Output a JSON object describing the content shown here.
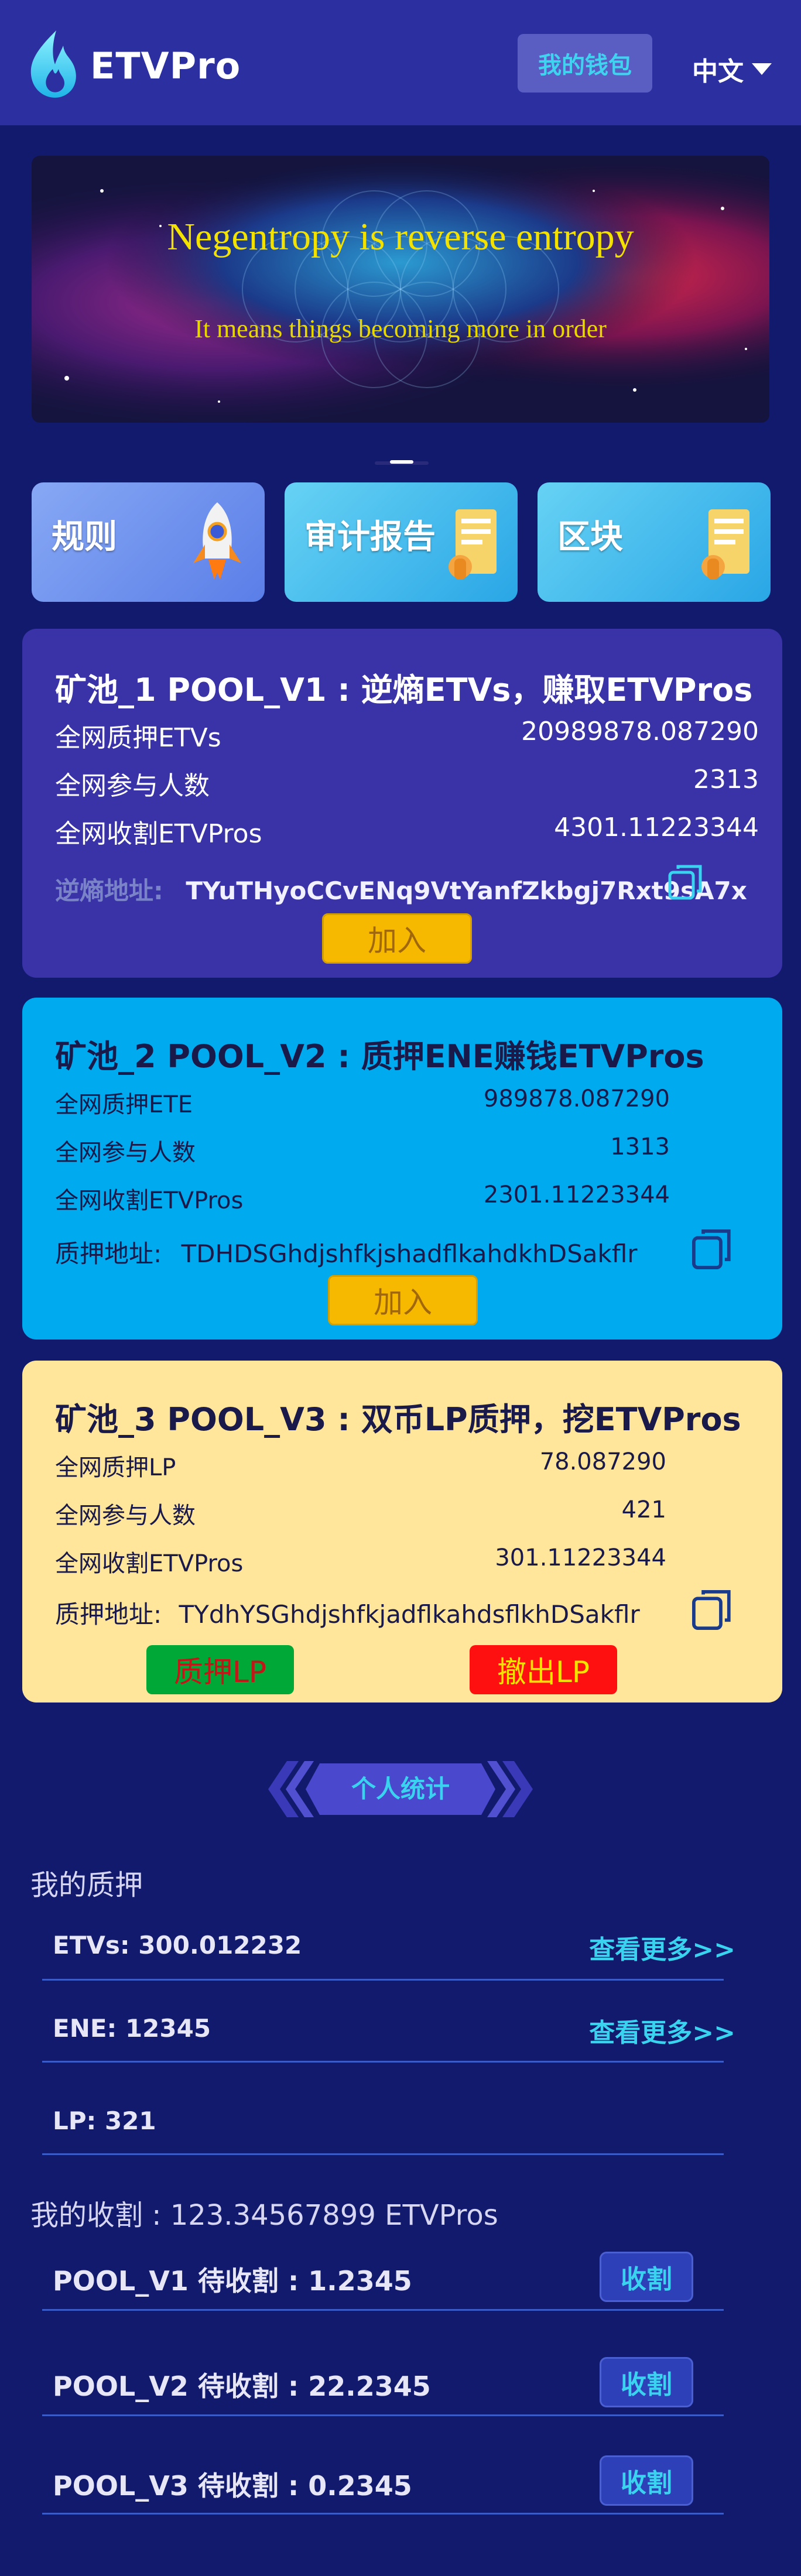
{
  "header": {
    "brand": "ETVPro",
    "wallet_label": "我的钱包",
    "lang_label": "中文"
  },
  "banner": {
    "line1": "Negentropy is reverse entropy",
    "line2": "It means things becoming more in order"
  },
  "nav": [
    {
      "label": "规则",
      "icon": "rocket-icon"
    },
    {
      "label": "审计报告",
      "icon": "report-icon"
    },
    {
      "label": "区块",
      "icon": "block-icon"
    }
  ],
  "pools": [
    {
      "title": "矿池_1  POOL_V1 : 逆熵ETVs，赚取ETVPros",
      "rows": [
        {
          "label": "全网质押ETVs",
          "value": "20989878.087290"
        },
        {
          "label": "全网参与人数",
          "value": "2313"
        },
        {
          "label": "全网收割ETVPros",
          "value": "4301.11223344"
        }
      ],
      "addr_label": "逆熵地址:",
      "addr": "TYuTHyoCCvENq9VtYanfZkbgj7Rxt9sA7x",
      "button": "加入",
      "bg": "#3a33a8"
    },
    {
      "title": "矿池_2  POOL_V2 : 质押ENE赚钱ETVPros",
      "rows": [
        {
          "label": "全网质押ETE",
          "value": "989878.087290"
        },
        {
          "label": "全网参与人数",
          "value": "1313"
        },
        {
          "label": "全网收割ETVPros",
          "value": "2301.11223344"
        }
      ],
      "addr_label": "质押地址:",
      "addr": "TDHDSGhdjshfkjshadflkahdkhDSakflr",
      "button": "加入",
      "bg": "#00aaee"
    },
    {
      "title": "矿池_3  POOL_V3 : 双币LP质押，挖ETVPros",
      "rows": [
        {
          "label": "全网质押LP",
          "value": "78.087290"
        },
        {
          "label": "全网参与人数",
          "value": "421"
        },
        {
          "label": "全网收割ETVPros",
          "value": "301.11223344"
        }
      ],
      "addr_label": "质押地址:",
      "addr": "TYdhYSGhdjshfkjadflkahdsflkhDSakflr",
      "stake_button": "质押LP",
      "withdraw_button": "撤出LP",
      "bg": "#ffe69b"
    }
  ],
  "stats": {
    "badge": "个人统计",
    "my_stake_title": "我的质押",
    "stakes": [
      {
        "label": "ETVs: 300.012232",
        "more": "查看更多>>"
      },
      {
        "label": "ENE: 12345",
        "more": "查看更多>>"
      },
      {
        "label": "LP: 321",
        "more": ""
      }
    ],
    "harvest_title": "我的收割 : 123.34567899 ETVPros",
    "harvests": [
      {
        "label": "POOL_V1 待收割 : 1.2345",
        "button": "收割"
      },
      {
        "label": "POOL_V2 待收割 : 22.2345",
        "button": "收割"
      },
      {
        "label": "POOL_V3 待收割 : 0.2345",
        "button": "收割"
      }
    ]
  },
  "colors": {
    "page_bg": "#121a6e",
    "header_bg": "#2b2fa0",
    "accent_cyan": "#3ad3ef",
    "join_button": "#f7b800",
    "stake_lp_button": "#00a838",
    "withdraw_lp_button": "#ff1010"
  }
}
